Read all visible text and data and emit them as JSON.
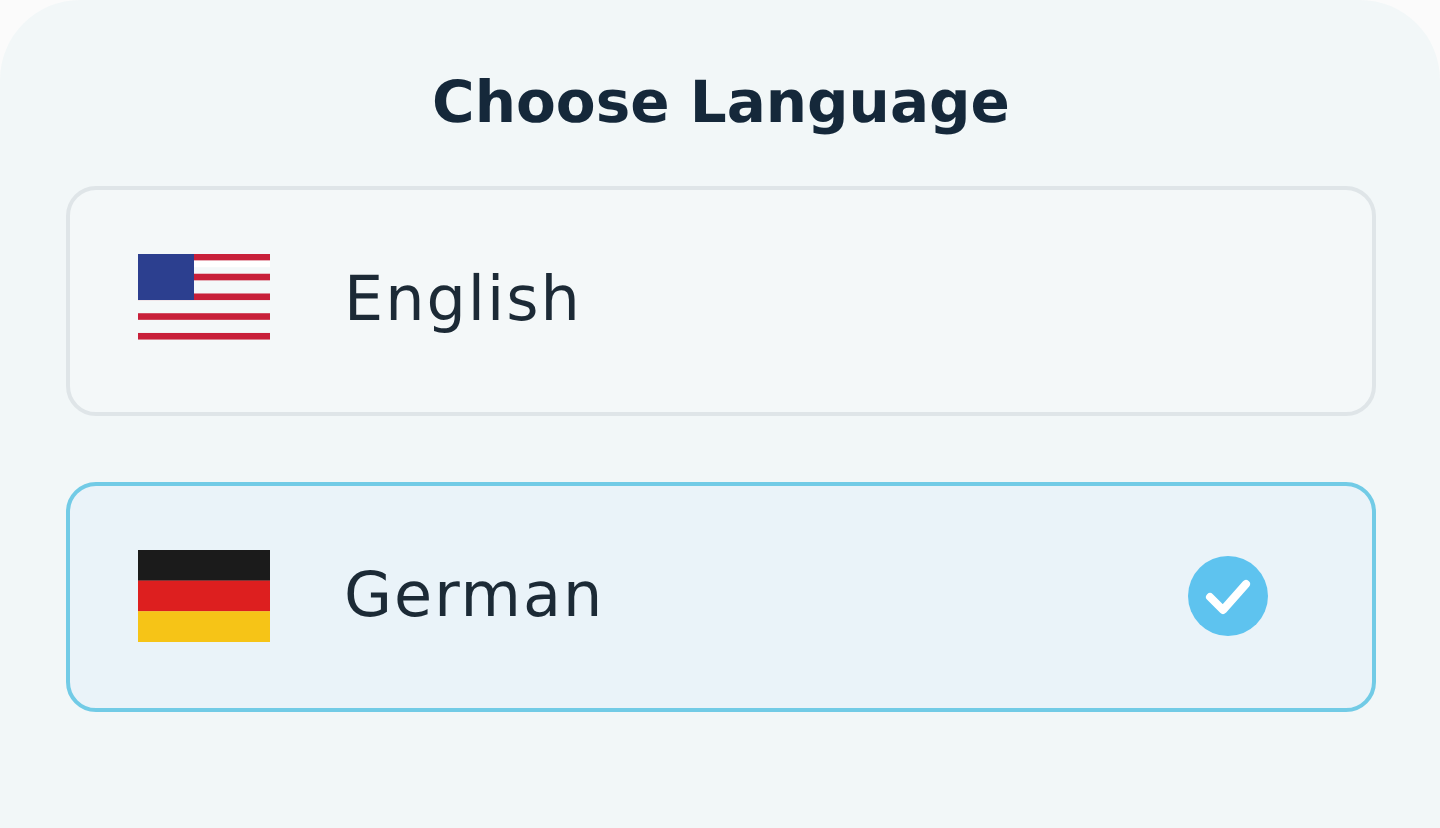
{
  "title": "Choose Language",
  "languages": [
    {
      "name": "English",
      "kind": "us",
      "selected": false
    },
    {
      "name": "German",
      "kind": "de",
      "selected": true
    }
  ]
}
